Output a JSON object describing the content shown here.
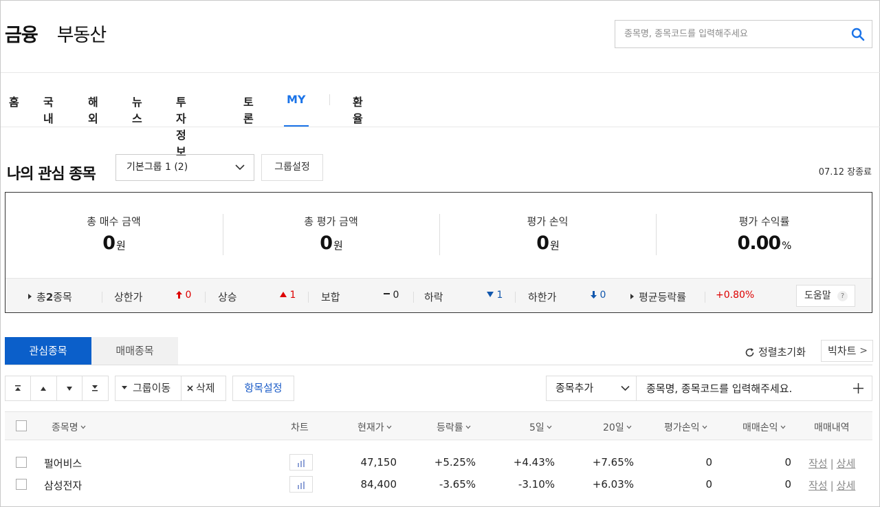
{
  "header": {
    "brand_primary": "금융",
    "brand_secondary": "부동산",
    "search_placeholder": "종목명, 종목코드를 입력해주세요"
  },
  "nav": {
    "items": [
      "홈",
      "국내",
      "해외",
      "뉴스",
      "투자정보",
      "토론",
      "MY",
      "환율"
    ],
    "active": "MY"
  },
  "watchlist": {
    "title": "나의 관심 종목",
    "group_select": "기본그룹 1 (2)",
    "group_settings": "그룹설정",
    "date_status": "07.12 장종료"
  },
  "summary": {
    "cols": [
      {
        "label": "총 매수 금액",
        "value": "0",
        "unit": "원"
      },
      {
        "label": "총 평가 금액",
        "value": "0",
        "unit": "원"
      },
      {
        "label": "평가 손익",
        "value": "0",
        "unit": "원"
      },
      {
        "label": "평가 수익률",
        "value": "0.00",
        "unit": "%"
      }
    ],
    "bar": {
      "total_prefix": "총",
      "total_count": "2",
      "total_suffix": "종목",
      "upper_limit_label": "상한가",
      "upper_limit_value": "0",
      "rise_label": "상승",
      "rise_value": "1",
      "flat_label": "보합",
      "flat_value": "0",
      "fall_label": "하락",
      "fall_value": "1",
      "lower_limit_label": "하한가",
      "lower_limit_value": "0",
      "avg_change_label": "평균등락률",
      "avg_change_value": "+0.80%",
      "help_label": "도움말",
      "help_q": "?"
    }
  },
  "tabs": {
    "watch": "관심종목",
    "trade": "매매종목",
    "reset_sort": "정렬초기화",
    "big_chart": "빅차트"
  },
  "toolbar": {
    "group_move": "그룹이동",
    "delete": "삭제",
    "item_settings": "항목설정",
    "add_select": "종목추가",
    "add_placeholder": "종목명, 종목코드를 입력해주세요."
  },
  "table": {
    "headers": {
      "name": "종목명",
      "chart": "차트",
      "price": "현재가",
      "change": "등락률",
      "d5": "5일",
      "d20": "20일",
      "eval_pl": "평가손익",
      "trade_pl": "매매손익",
      "history": "매매내역"
    },
    "rows": [
      {
        "name": "펄어비스",
        "price": "47,150",
        "change": "+5.25%",
        "d5": "+4.43%",
        "d20": "+7.65%",
        "eval_pl": "0",
        "trade_pl": "0",
        "write": "작성",
        "detail": "상세"
      },
      {
        "name": "삼성전자",
        "price": "84,400",
        "change": "-3.65%",
        "d5": "-3.10%",
        "d20": "+6.03%",
        "eval_pl": "0",
        "trade_pl": "0",
        "write": "작성",
        "detail": "상세"
      }
    ]
  },
  "colors": {
    "accent": "#1a73e8",
    "tab_active": "#0b5fca",
    "up": "#dd0000",
    "down": "#1157ad"
  }
}
